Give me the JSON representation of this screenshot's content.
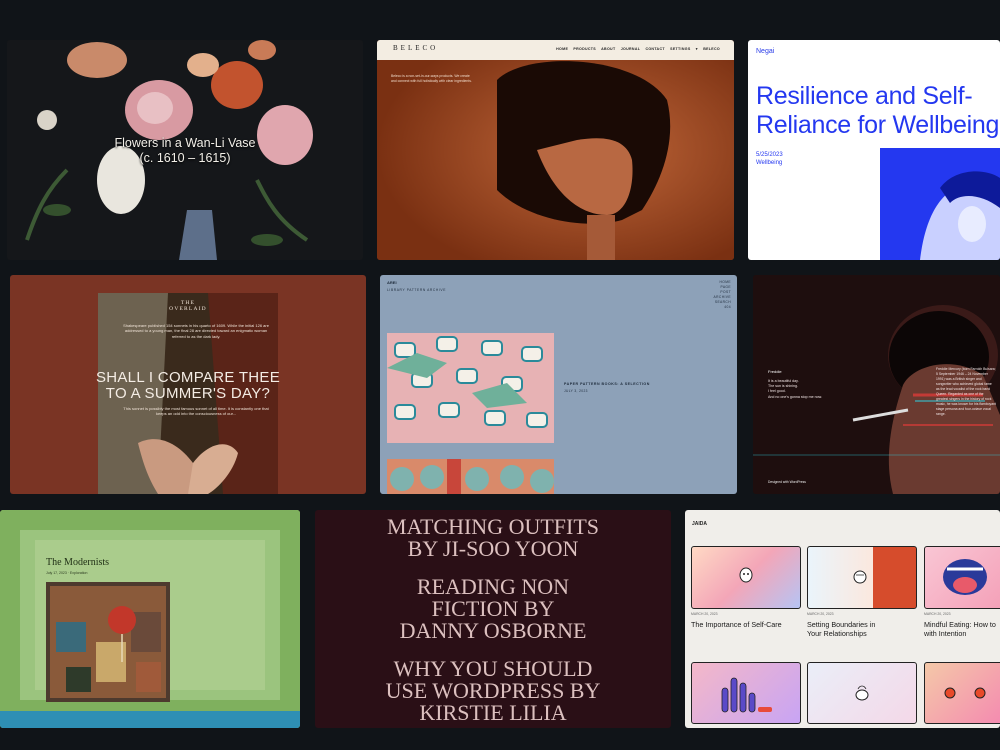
{
  "card_flowers": {
    "title_line1": "Flowers in a Wan-Li Vase",
    "title_line2": "(c. 1610 – 1615)"
  },
  "card_beleco": {
    "logo": "BELECO",
    "menu": "HOME PRODUCTS ABOUT JOURNAL CONTACT SETTINGS ▾ BELECO",
    "intro": "Beleco is a non-set-in-our-ways products. We create and connect with full holistically with clear ingredients."
  },
  "card_wellbeing": {
    "brand": "Negai",
    "headline_line1": "Resilience and Self-",
    "headline_line2": "Reliance for Wellbeing",
    "date": "5/25/2023",
    "category": "Wellbeing",
    "colors": {
      "accent": "#2438f0"
    }
  },
  "card_overlap": {
    "logo_line1": "THE",
    "logo_line2": "OVERLAID",
    "intro": "Shakespeare published 154 sonnets in his quarto of 1609. While the initial 126 are addressed to a young man, the final 28 are directed toward an enigmatic woman referred to as the dark lady.",
    "heading_line1": "SHALL I COMPARE THEE",
    "heading_line2": "TO A SUMMER'S DAY?",
    "body": "This sonnet is possibly the most famous sonnet of all time. It is constantly one that keeps an odd into the consciousness of our..."
  },
  "card_fabric": {
    "brand": "AREI",
    "subtitle": "LIBRARY PATTERN ARCHIVE",
    "nav": [
      "HOME",
      "PAGE",
      "POST",
      "ARCHIVE",
      "SEARCH",
      "404"
    ],
    "post_title": "PAPER PATTERN BOOKS: A SELECTION",
    "post_date": "JULY 3, 2023"
  },
  "card_freddie": {
    "name": "Freddie",
    "poem": [
      "It is a beautiful day.",
      "The sun is shining.",
      "I feel good.",
      "And no one's gonna stop me now."
    ],
    "bio": "Freddie Mercury (born Farrokh Bulsara; 5 September 1946 – 24 November 1991) was a British singer and songwriter who achieved global fame as the lead vocalist of the rock band Queen. Regarded as one of the greatest singers in the history of rock music, he was known for his flamboyant stage persona and four-octave vocal range.",
    "footer": "Designed with WordPress"
  },
  "card_modernists": {
    "title": "The Modernists",
    "meta": "July 17, 2023 · Exploration"
  },
  "card_outfits": {
    "posts": [
      {
        "line1": "MATCHING OUTFITS",
        "line2": "BY JI-SOO YOON"
      },
      {
        "line1": "READING NON",
        "line2": "FICTION BY",
        "line3": "DANNY OSBORNE"
      },
      {
        "line1": "WHY YOU SHOULD",
        "line2": "USE WORDPRESS BY",
        "line3": "KIRSTIE LILIA"
      }
    ]
  },
  "card_jaida": {
    "brand": "JAIDA",
    "posts": [
      {
        "date": "MARCH 20, 2023",
        "title_line1": "The Importance of Self-Care",
        "title_line2": ""
      },
      {
        "date": "MARCH 20, 2023",
        "title_line1": "Setting Boundaries in",
        "title_line2": "Your Relationships"
      },
      {
        "date": "MARCH 20, 2023",
        "title_line1": "Mindful Eating: How to",
        "title_line2": "with Intention"
      }
    ]
  }
}
